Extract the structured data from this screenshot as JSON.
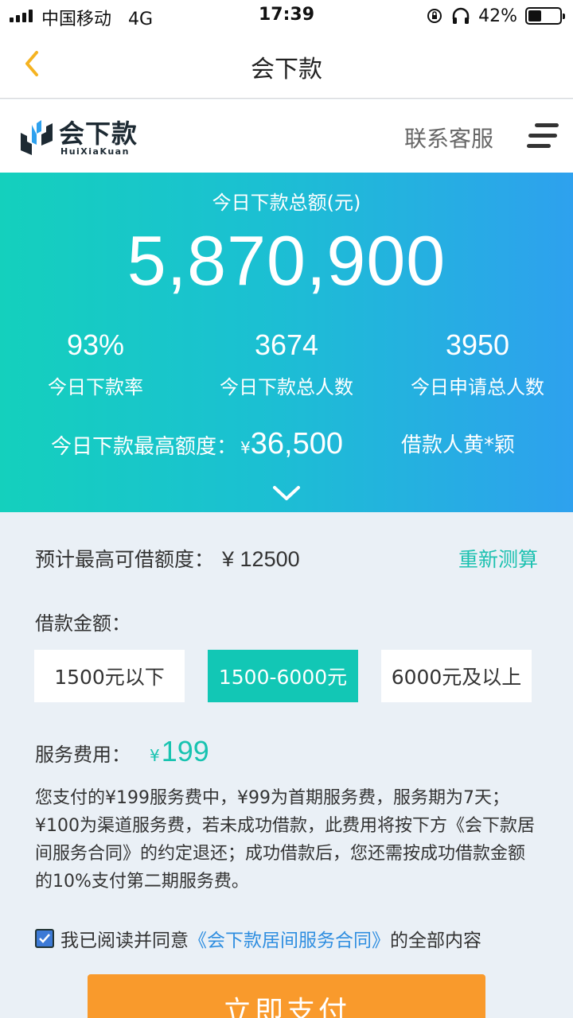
{
  "status_bar": {
    "carrier": "中国移动",
    "network": "4G",
    "time": "17:39",
    "battery_pct": "42%",
    "battery_level": 0.42
  },
  "navbar": {
    "title": "会下款"
  },
  "brand": {
    "name": "会下款",
    "subtitle": "HuiXiaKuan",
    "contact": "联系客服"
  },
  "hero": {
    "label": "今日下款总额(元)",
    "total": "5,870,900",
    "stats": [
      {
        "value": "93%",
        "label": "今日下款率"
      },
      {
        "value": "3674",
        "label": "今日下款总人数"
      },
      {
        "value": "3950",
        "label": "今日申请总人数"
      }
    ],
    "max_label": "今日下款最高额度：",
    "max_currency": "¥",
    "max_amount": "36,500",
    "borrower": "借款人黄*颖"
  },
  "form": {
    "estimate_label": "预计最高可借额度：",
    "estimate_amount": "¥ 12500",
    "recalc": "重新测算",
    "loan_label": "借款金额：",
    "options": [
      {
        "label": "1500元以下",
        "selected": false
      },
      {
        "label": "1500-6000元",
        "selected": true
      },
      {
        "label": "6000元及以上",
        "selected": false
      }
    ],
    "fee_label": "服务费用：",
    "fee_currency": "¥",
    "fee_amount": "199",
    "description": "您支付的¥199服务费中，¥99为首期服务费，服务期为7天；¥100为渠道服务费，若未成功借款，此费用将按下方《会下款居间服务合同》的约定退还；成功借款后，您还需按成功借款金额的10%支付第二期服务费。",
    "agree_prefix": "我已阅读并同意",
    "agree_link": "《会下款居间服务合同》",
    "agree_suffix": "的全部内容",
    "agree_checked": true,
    "pay_button": "立即支付"
  },
  "colors": {
    "accent": "#12c7b5",
    "gradient_start": "#14d0bd",
    "gradient_end": "#2ea1ee",
    "pay": "#f99a2c",
    "link": "#2f8ee0",
    "back_arrow": "#f5b321"
  }
}
